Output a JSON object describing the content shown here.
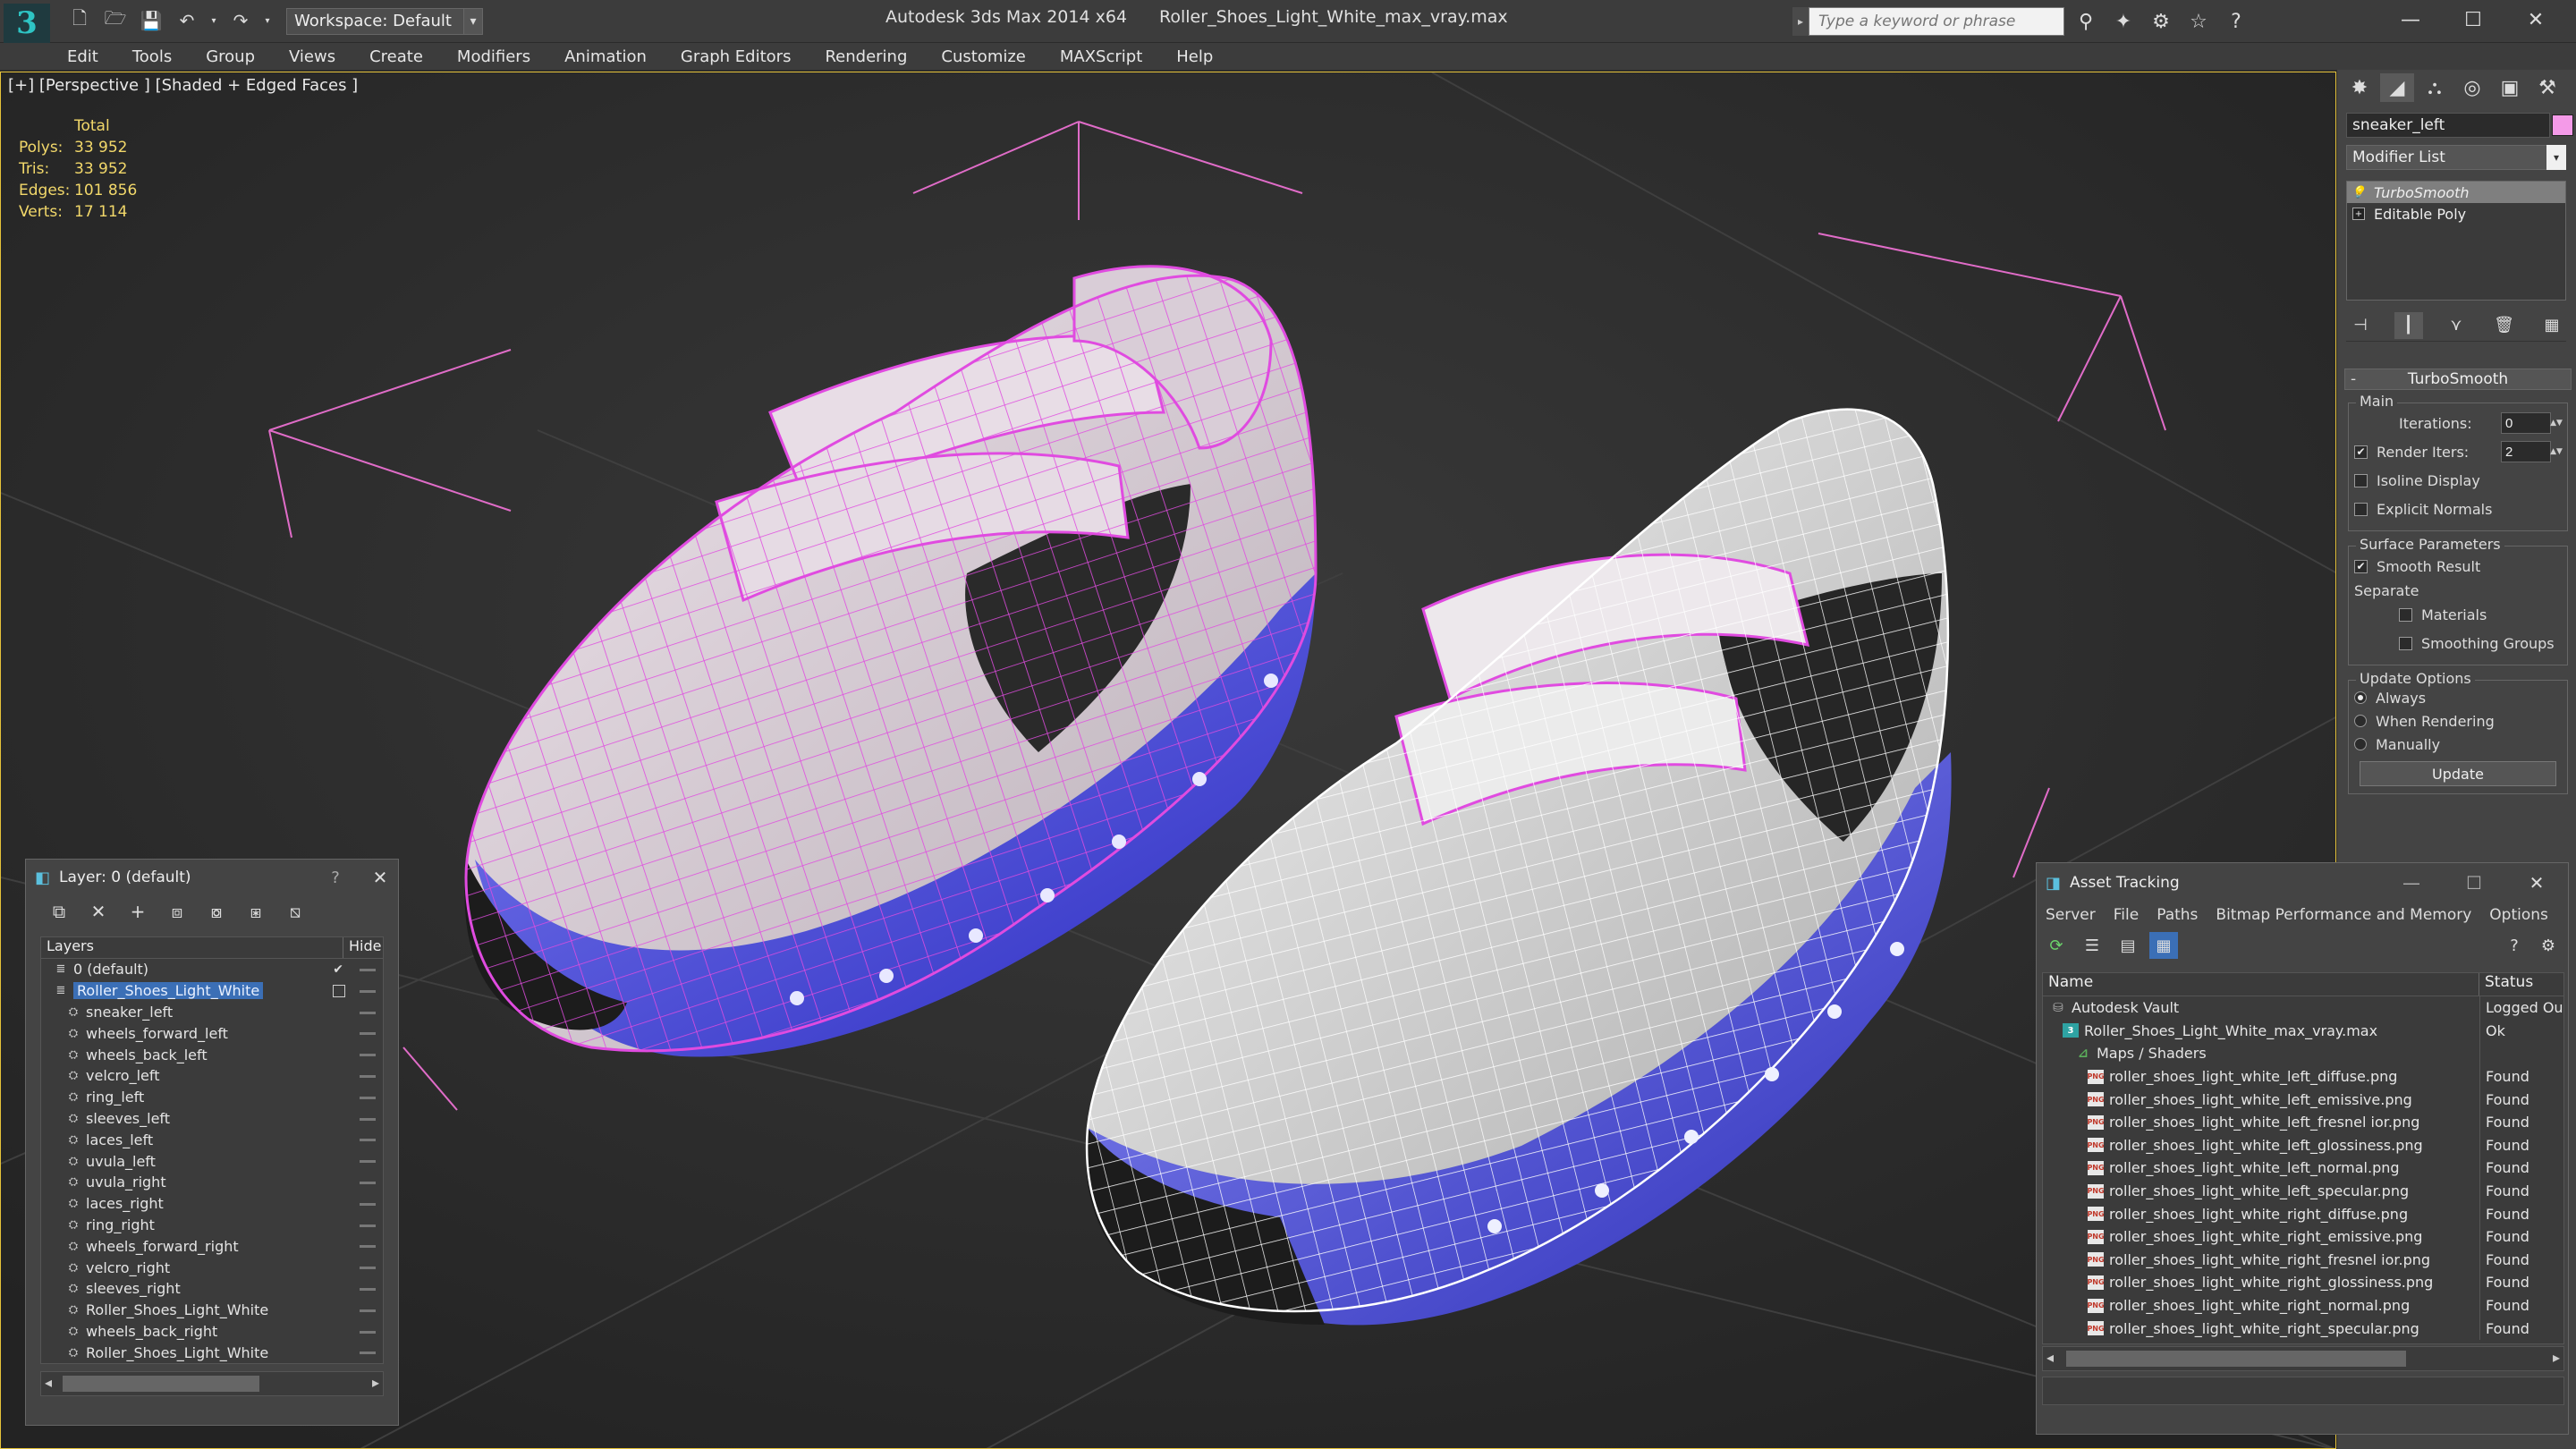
{
  "titlebar": {
    "workspace": "Workspace: Default",
    "app": "Autodesk 3ds Max  2014 x64",
    "file": "Roller_Shoes_Light_White_max_vray.max",
    "search_placeholder": "Type a keyword or phrase"
  },
  "menu": [
    "Edit",
    "Tools",
    "Group",
    "Views",
    "Create",
    "Modifiers",
    "Animation",
    "Graph Editors",
    "Rendering",
    "Customize",
    "MAXScript",
    "Help"
  ],
  "viewport": {
    "label": "[+] [Perspective ] [Shaded + Edged Faces ]",
    "stats_header": "Total",
    "stats": [
      {
        "k": "Polys:",
        "v": "33 952"
      },
      {
        "k": "Tris:",
        "v": "33 952"
      },
      {
        "k": "Edges:",
        "v": "101 856"
      },
      {
        "k": "Verts:",
        "v": "17 114"
      }
    ],
    "wire_color": "#e04be0",
    "sole_color": "#4a4ce6"
  },
  "command_panel": {
    "object_name": "sneaker_left",
    "object_color": "#f49ae8",
    "modifier_list": "Modifier List",
    "stack": [
      "TurboSmooth",
      "Editable Poly"
    ],
    "rollout_title": "TurboSmooth",
    "main_group": "Main",
    "iterations_label": "Iterations:",
    "iterations_value": "0",
    "render_iters_label": "Render Iters:",
    "render_iters_value": "2",
    "isoline": "Isoline Display",
    "explicit_normals": "Explicit Normals",
    "surface_group": "Surface Parameters",
    "smooth_result": "Smooth Result",
    "separate": "Separate",
    "materials": "Materials",
    "smoothing_groups": "Smoothing Groups",
    "update_group": "Update Options",
    "always": "Always",
    "when_rendering": "When Rendering",
    "manually": "Manually",
    "update_btn": "Update"
  },
  "layer_window": {
    "title": "Layer: 0 (default)",
    "q": "?",
    "col_layers": "Layers",
    "col_hide": "Hide",
    "rows": [
      {
        "name": "0 (default)",
        "level": 1,
        "type": "layer",
        "check": true
      },
      {
        "name": "Roller_Shoes_Light_White",
        "level": 1,
        "type": "layer",
        "selected": true
      },
      {
        "name": "sneaker_left",
        "level": 2,
        "type": "obj"
      },
      {
        "name": "wheels_forward_left",
        "level": 2,
        "type": "obj"
      },
      {
        "name": "wheels_back_left",
        "level": 2,
        "type": "obj"
      },
      {
        "name": "velcro_left",
        "level": 2,
        "type": "obj"
      },
      {
        "name": "ring_left",
        "level": 2,
        "type": "obj"
      },
      {
        "name": "sleeves_left",
        "level": 2,
        "type": "obj"
      },
      {
        "name": "laces_left",
        "level": 2,
        "type": "obj"
      },
      {
        "name": "uvula_left",
        "level": 2,
        "type": "obj"
      },
      {
        "name": "uvula_right",
        "level": 2,
        "type": "obj"
      },
      {
        "name": "laces_right",
        "level": 2,
        "type": "obj"
      },
      {
        "name": "ring_right",
        "level": 2,
        "type": "obj"
      },
      {
        "name": "wheels_forward_right",
        "level": 2,
        "type": "obj"
      },
      {
        "name": "velcro_right",
        "level": 2,
        "type": "obj"
      },
      {
        "name": "sleeves_right",
        "level": 2,
        "type": "obj"
      },
      {
        "name": "Roller_Shoes_Light_White",
        "level": 2,
        "type": "obj"
      },
      {
        "name": "wheels_back_right",
        "level": 2,
        "type": "obj"
      },
      {
        "name": "Roller_Shoes_Light_White",
        "level": 2,
        "type": "obj"
      }
    ]
  },
  "asset_window": {
    "title": "Asset Tracking",
    "menu": [
      "Server",
      "File",
      "Paths",
      "Bitmap Performance and Memory",
      "Options"
    ],
    "col_name": "Name",
    "col_status": "Status",
    "rows": [
      {
        "name": "Autodesk Vault",
        "status": "Logged Ou",
        "level": 1,
        "icon": "vault"
      },
      {
        "name": "Roller_Shoes_Light_White_max_vray.max",
        "status": "Ok",
        "level": 2,
        "icon": "max"
      },
      {
        "name": "Maps / Shaders",
        "status": "",
        "level": 3,
        "icon": "maps"
      },
      {
        "name": "roller_shoes_light_white_left_diffuse.png",
        "status": "Found",
        "level": 4,
        "icon": "png"
      },
      {
        "name": "roller_shoes_light_white_left_emissive.png",
        "status": "Found",
        "level": 4,
        "icon": "png"
      },
      {
        "name": "roller_shoes_light_white_left_fresnel ior.png",
        "status": "Found",
        "level": 4,
        "icon": "png"
      },
      {
        "name": "roller_shoes_light_white_left_glossiness.png",
        "status": "Found",
        "level": 4,
        "icon": "png"
      },
      {
        "name": "roller_shoes_light_white_left_normal.png",
        "status": "Found",
        "level": 4,
        "icon": "png"
      },
      {
        "name": "roller_shoes_light_white_left_specular.png",
        "status": "Found",
        "level": 4,
        "icon": "png"
      },
      {
        "name": "roller_shoes_light_white_right_diffuse.png",
        "status": "Found",
        "level": 4,
        "icon": "png"
      },
      {
        "name": "roller_shoes_light_white_right_emissive.png",
        "status": "Found",
        "level": 4,
        "icon": "png"
      },
      {
        "name": "roller_shoes_light_white_right_fresnel ior.png",
        "status": "Found",
        "level": 4,
        "icon": "png"
      },
      {
        "name": "roller_shoes_light_white_right_glossiness.png",
        "status": "Found",
        "level": 4,
        "icon": "png"
      },
      {
        "name": "roller_shoes_light_white_right_normal.png",
        "status": "Found",
        "level": 4,
        "icon": "png"
      },
      {
        "name": "roller_shoes_light_white_right_specular.png",
        "status": "Found",
        "level": 4,
        "icon": "png"
      }
    ]
  }
}
